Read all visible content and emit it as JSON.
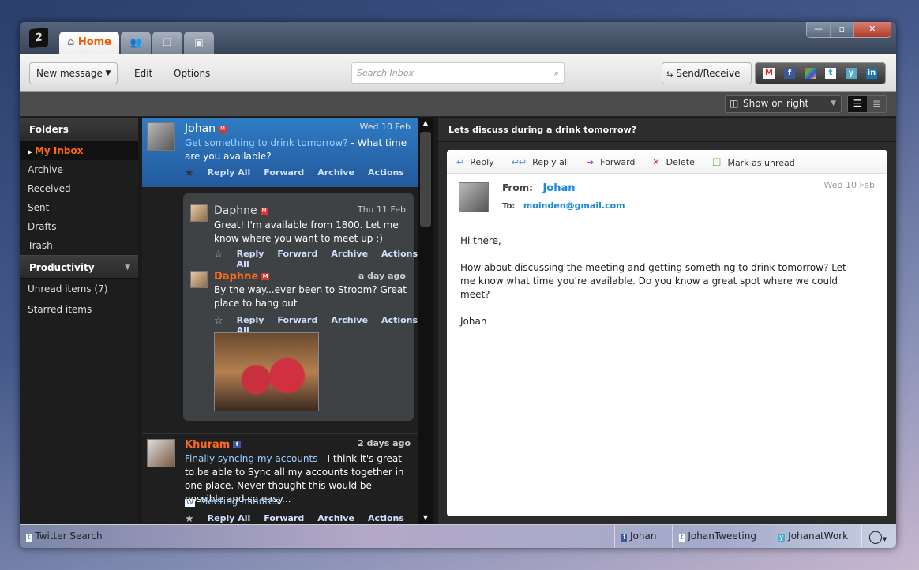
{
  "tabs": {
    "home": "Home",
    "contacts": "contacts-icon",
    "documents": "documents-icon",
    "photos": "photos-icon"
  },
  "window_controls": {
    "minimize": "—",
    "maximize": "▫",
    "close": "✕"
  },
  "toolbar": {
    "new_message": "New message",
    "edit": "Edit",
    "options": "Options",
    "search_placeholder": "Search Inbox",
    "send_receive": "Send/Receive",
    "accounts": [
      "Gmail",
      "Facebook",
      "Windows Live",
      "Twitter",
      "Yammer",
      "LinkedIn"
    ]
  },
  "view": {
    "layout": "Show on right"
  },
  "sidebar": {
    "folders_title": "Folders",
    "folders": [
      "My Inbox",
      "Archive",
      "Received",
      "Sent",
      "Drafts",
      "Trash"
    ],
    "productivity_title": "Productivity",
    "unread_label": "Unread items",
    "unread_count": "(7)",
    "starred_label": "Starred items"
  },
  "messages": [
    {
      "name": "Johan",
      "date": "Wed 10 Feb",
      "subject": "Get something to drink tomorrow?",
      "preview": " - What time are you available?"
    },
    {
      "name": "Daphne",
      "date": "Thu 11 Feb",
      "body": "Great! I'm available from 1800. Let me know where you want to meet up ;)"
    },
    {
      "name": "Daphne",
      "date": "a day ago",
      "body": "By the way...ever been to Stroom? Great place to hang out"
    },
    {
      "name": "Khuram",
      "date": "2 days ago",
      "subject": "Finally syncing my accounts",
      "preview": " - I think it's great to be able to Sync all my accounts together in one place. Never thought this would be possible and so easy...",
      "attachment": "Meeting minutes"
    }
  ],
  "msg_actions": {
    "reply_all": "Reply All",
    "forward": "Forward",
    "archive": "Archive",
    "actions": "Actions"
  },
  "reader": {
    "title": "Lets discuss during a drink tomorrow?",
    "reply": "Reply",
    "reply_all": "Reply all",
    "forward": "Forward",
    "delete": "Delete",
    "mark_unread": "Mark as unread",
    "from_label": "From:",
    "from": "Johan",
    "to_label": "To:",
    "to": "moinden@gmail.com",
    "date": "Wed 10 Feb",
    "greeting": "Hi there,",
    "body": "How about discussing the meeting and getting something to drink tomorrow? Let me know what time you're available. Do you know a great spot where we could meet?",
    "signature": "Johan"
  },
  "bottom": {
    "twitter_search": "Twitter Search",
    "accounts": [
      "Johan",
      "JohanTweeting",
      "JohanatWork"
    ]
  },
  "colors": {
    "accent": "#f05a00",
    "selected": "#2a6db5",
    "link": "#1a8ad8"
  }
}
